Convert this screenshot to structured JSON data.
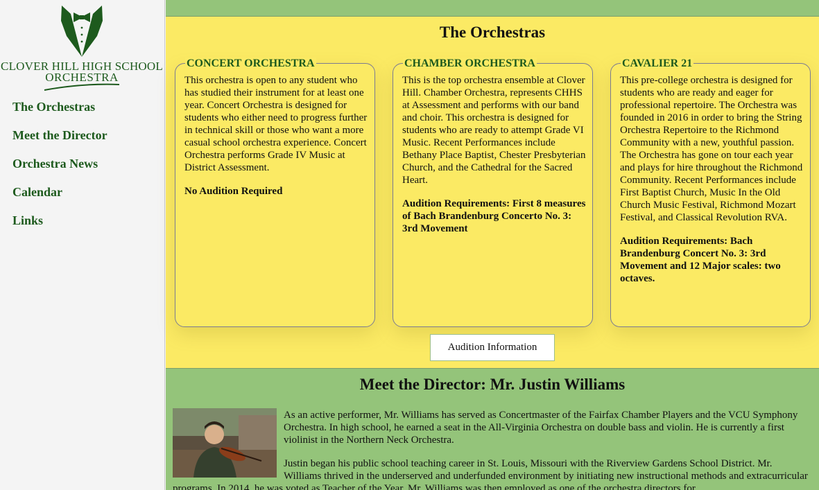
{
  "logo": {
    "line1": "CLOVER HILL HIGH SCHOOL",
    "line2": "ORCHESTRA",
    "icon": "tuxedo-bowtie-icon"
  },
  "nav": [
    {
      "label": "The Orchestras"
    },
    {
      "label": "Meet the Director"
    },
    {
      "label": "Orchestra News"
    },
    {
      "label": "Calendar"
    },
    {
      "label": "Links"
    }
  ],
  "orchestras": {
    "title": "The Orchestras",
    "cards": [
      {
        "name": "CONCERT ORCHESTRA",
        "description": "This orchestra is open to any student who has studied their instrument for at least one year. Concert Orchestra is designed for students who either need to progress further in technical skill or those who want a more casual school orchestra experience. Concert Orchestra performs Grade IV Music at District Assessment.",
        "requirement": "No Audition Required"
      },
      {
        "name": "CHAMBER ORCHESTRA",
        "description": "This is the top orchestra ensemble at Clover Hill. Chamber Orchestra, represents CHHS at Assessment and performs with our band and choir. This orchestra is designed for students who are ready to attempt Grade VI Music. Recent Performances include Bethany Place Baptist, Chester Presbyterian Church, and the Cathedral for the Sacred Heart.",
        "requirement": "Audition Requirements: First 8 measures of Bach Brandenburg Concerto No. 3: 3rd Movement"
      },
      {
        "name": "CAVALIER 21",
        "description": "This pre-college orchestra is designed for students who are ready and eager for professional repertoire. The Orchestra was founded in 2016 in order to bring the String Orchestra Repertoire to the Richmond Community with a new, youthful passion. The Orchestra has gone on tour each year and plays for hire throughout the Richmond Community. Recent Performances include First Baptist Church, Music In the Old Church Music Festival, Richmond Mozart Festival, and Classical Revolution RVA.",
        "requirement": "Audition Requirements: Bach Brandenburg Concert No. 3: 3rd Movement and 12 Major scales: two octaves."
      }
    ],
    "button_label": "Audition Information"
  },
  "director": {
    "title": "Meet the Director: Mr. Justin Williams",
    "paragraph1": "As an active performer, Mr. Williams has served as Concertmaster of the Fairfax Chamber Players and the VCU Symphony Orchestra. In high school, he earned a seat in the All-Virginia Orchestra on double bass and violin. He is currently a first violinist in the Northern Neck Orchestra.",
    "paragraph2": "Justin began his public school teaching career in St. Louis, Missouri with the Riverview Gardens School District. Mr. Williams thrived in the underserved and underfunded environment by initiating new instructional methods and extracurricular programs. In 2014, he was voted as Teacher of the Year. Mr. Williams was then employed as one of the orchestra directors for"
  },
  "colors": {
    "brand_green": "#1d5a1d",
    "section_yellow": "#fbea64",
    "section_green": "#94c47a",
    "sidebar_bg": "#f4f4f4"
  }
}
